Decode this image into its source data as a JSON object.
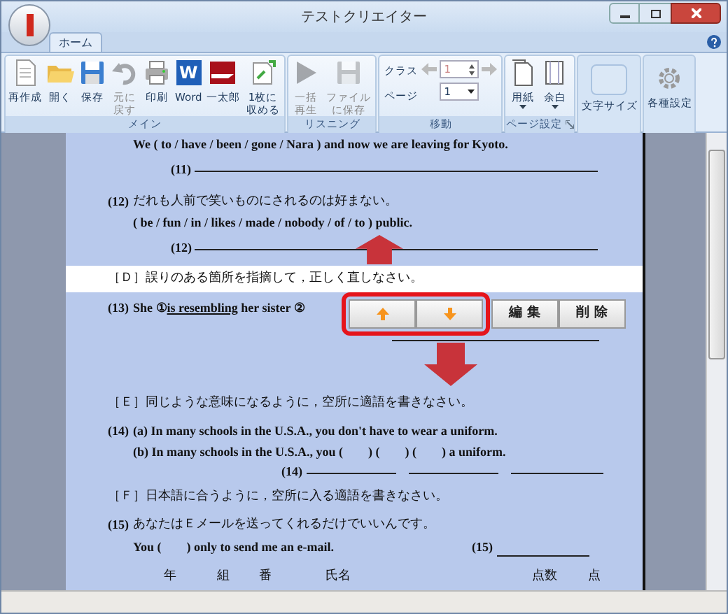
{
  "window": {
    "title": "テストクリエイター"
  },
  "tabs": [
    {
      "label": "ホーム",
      "selected": true
    }
  ],
  "ribbon": [
    {
      "kind": "buttons",
      "label": "メイン",
      "items": [
        {
          "kind": "new",
          "label": "再作成",
          "disabled": false
        },
        {
          "kind": "open",
          "label": "開く",
          "disabled": false
        },
        {
          "kind": "save",
          "label": "保存",
          "disabled": false
        },
        {
          "kind": "undo",
          "label": "元に戻す",
          "disabled": true
        },
        {
          "kind": "print",
          "label": "印刷",
          "disabled": false
        },
        {
          "kind": "word",
          "label": "Word",
          "glyph": "W",
          "disabled": false
        },
        {
          "kind": "ichitaro",
          "label": "一太郎",
          "disabled": false
        },
        {
          "kind": "fit",
          "label": "1枚に収める",
          "disabled": false
        }
      ]
    },
    {
      "kind": "buttons",
      "label": "リスニング",
      "items": [
        {
          "kind": "play",
          "label": "一括再生",
          "disabled": true
        },
        {
          "kind": "save",
          "label": "ファイルに保存",
          "disabled": true
        }
      ]
    },
    {
      "kind": "nav",
      "label": "移動",
      "class_label": "クラス",
      "page_label": "ページ",
      "class_value": "1",
      "page_value": "1"
    },
    {
      "kind": "buttons",
      "label": "ページ設定",
      "launcher": true,
      "items": [
        {
          "kind": "paper",
          "label": "用紙",
          "dropdown": true,
          "disabled": false
        },
        {
          "kind": "margin",
          "label": "余白",
          "dropdown": true,
          "disabled": false
        }
      ]
    },
    {
      "kind": "big",
      "items": [
        {
          "kind": "blank",
          "label": "文字サイズ",
          "disabled": false
        }
      ]
    },
    {
      "kind": "big",
      "items": [
        {
          "kind": "gear",
          "label": "各種設定",
          "disabled": false
        }
      ]
    }
  ],
  "document": [
    {
      "kind": "cont",
      "text": "We ( to / have / been / gone / Nara ) and now we are leaving for Kyoto."
    },
    {
      "kind": "answer",
      "label": "(11)"
    },
    {
      "kind": "question",
      "number": "(12)",
      "text": "だれも人前で笑いものにされるのは好まない。"
    },
    {
      "kind": "cont",
      "text": "( be / fun / in / likes / made / nobody / of / to ) public."
    },
    {
      "kind": "answer",
      "label": "(12)"
    },
    {
      "kind": "heading",
      "text": "［Ｄ］誤りのある箇所を指摘して，正しく直しなさい。",
      "selected": true
    },
    {
      "kind": "parts",
      "number": "(13)",
      "parts": [
        {
          "text": "She ①",
          "underlined": false
        },
        {
          "text": "is resembling",
          "underlined": true
        },
        {
          "text": " her sister ②",
          "underlined": false
        }
      ]
    },
    {
      "kind": "answer"
    },
    {
      "kind": "heading",
      "text": "［Ｅ］同じような意味になるように，空所に適語を書きなさい。",
      "selected": false
    },
    {
      "kind": "question",
      "number": "(14)",
      "text": "(a) In many schools in the U.S.A., you don't have to wear a uniform."
    },
    {
      "kind": "cont",
      "text": "(b) In many schools in the U.S.A., you (　　) (　　) (　　) a uniform."
    },
    {
      "kind": "answer3",
      "label": "(14)"
    },
    {
      "kind": "heading",
      "text": "［Ｆ］日本語に合うように，空所に入る適語を書きなさい。",
      "selected": false
    },
    {
      "kind": "question",
      "number": "(15)",
      "text": "あなたはＥメールを送ってくれるだけでいいんです。"
    },
    {
      "kind": "cont_answer",
      "text": "You (　　) only to send me an e-mail.",
      "label": "(15)"
    },
    {
      "kind": "namerow",
      "fields": [
        "年",
        "組",
        "番",
        "氏名",
        "点数",
        "点"
      ]
    }
  ],
  "row_tools": {
    "framed": [
      {
        "kind": "up"
      },
      {
        "kind": "down"
      }
    ],
    "plain": [
      {
        "kind": "text",
        "label": "編 集"
      },
      {
        "kind": "text",
        "label": "削 除"
      }
    ]
  },
  "annotations": [
    {
      "kind": "up"
    },
    {
      "kind": "down"
    }
  ]
}
